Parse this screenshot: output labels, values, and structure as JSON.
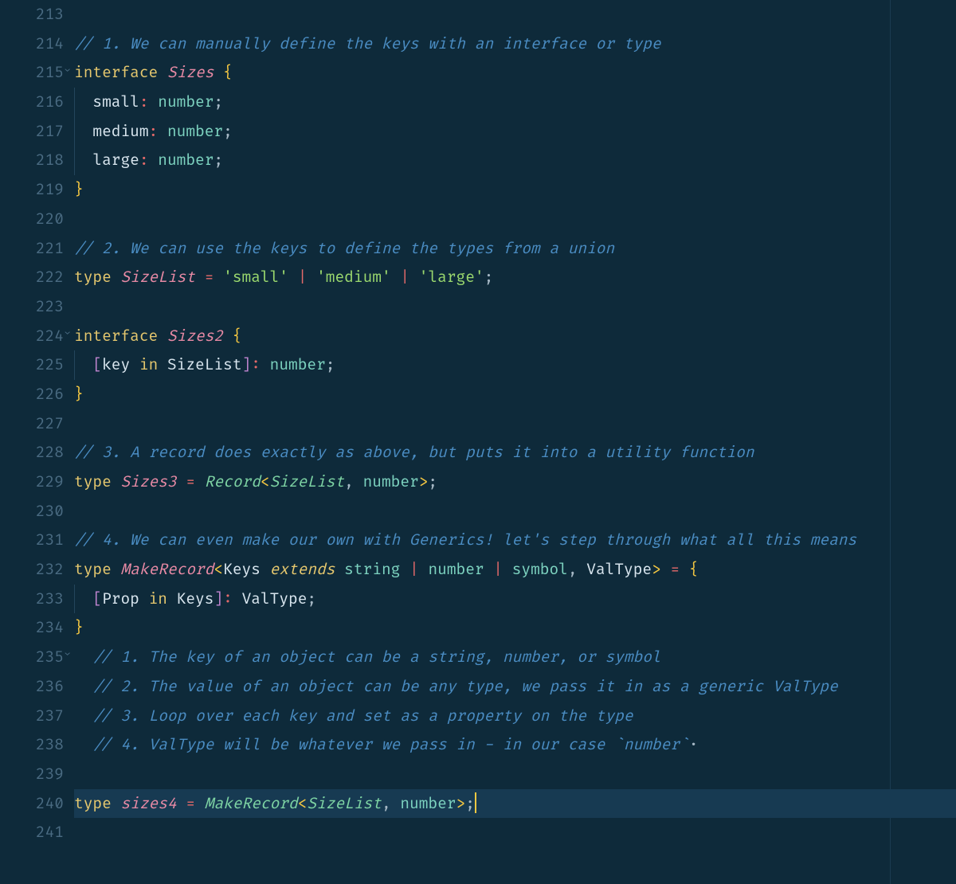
{
  "gutter": {
    "start": 213,
    "end": 241,
    "foldLines": [
      215,
      224,
      235
    ]
  },
  "lines": {
    "l213": "",
    "l214": {
      "comment": "// 1. We can manually define the keys with an interface or type"
    },
    "l215": {
      "kw": "interface",
      "name": "Sizes",
      "brace": "{"
    },
    "l216": {
      "prop": "small",
      "colon": ":",
      "ptype": "number",
      "semi": ";"
    },
    "l217": {
      "prop": "medium",
      "colon": ":",
      "ptype": "number",
      "semi": ";"
    },
    "l218": {
      "prop": "large",
      "colon": ":",
      "ptype": "number",
      "semi": ";"
    },
    "l219": {
      "brace": "}"
    },
    "l220": "",
    "l221": {
      "comment": "// 2. We can use the keys to define the types from a union"
    },
    "l222": {
      "kw": "type",
      "name": "SizeList",
      "eq": "=",
      "s1": "'small'",
      "p1": "|",
      "s2": "'medium'",
      "p2": "|",
      "s3": "'large'",
      "semi": ";"
    },
    "l223": "",
    "l224": {
      "kw": "interface",
      "name": "Sizes2",
      "brace": "{"
    },
    "l225": {
      "lb": "[",
      "key": "key",
      "in": "in",
      "ref": "SizeList",
      "rb": "]",
      "colon": ":",
      "ptype": "number",
      "semi": ";"
    },
    "l226": {
      "brace": "}"
    },
    "l227": "",
    "l228": {
      "comment": "// 3. A record does exactly as above, but puts it into a utility function"
    },
    "l229": {
      "kw": "type",
      "name": "Sizes3",
      "eq": "=",
      "rec": "Record",
      "la": "<",
      "ref": "SizeList",
      "comma": ",",
      "ptype": "number",
      "ra": ">",
      "semi": ";"
    },
    "l230": "",
    "l231": {
      "comment": "// 4. We can even make our own with Generics! let's step through what all this means"
    },
    "l232": {
      "kw": "type",
      "name": "MakeRecord",
      "la": "<",
      "p1": "Keys",
      "ext": "extends",
      "t1": "string",
      "pipe1": "|",
      "t2": "number",
      "pipe2": "|",
      "t3": "symbol",
      "comma": ",",
      "p2": "ValType",
      "ra": ">",
      "eq": "=",
      "brace": "{"
    },
    "l233": {
      "lb": "[",
      "prop": "Prop",
      "in": "in",
      "ref": "Keys",
      "rb": "]",
      "colon": ":",
      "vt": "ValType",
      "semi": ";"
    },
    "l234": {
      "brace": "}"
    },
    "l235": {
      "comment": "// 1. The key of an object can be a string, number, or symbol"
    },
    "l236": {
      "comment": "// 2. The value of an object can be any type, we pass it in as a generic ValType"
    },
    "l237": {
      "comment": "// 3. Loop over each key and set as a property on the type"
    },
    "l238": {
      "comment": "// 4. ValType will be whatever we pass in - in our case `number`",
      "trail": "·"
    },
    "l239": "",
    "l240": {
      "kw": "type",
      "name": "sizes4",
      "eq": "=",
      "rec": "MakeRecord",
      "la": "<",
      "ref": "SizeList",
      "comma": ",",
      "ptype": "number",
      "ra": ">",
      "semi": ";"
    },
    "l241": ""
  }
}
